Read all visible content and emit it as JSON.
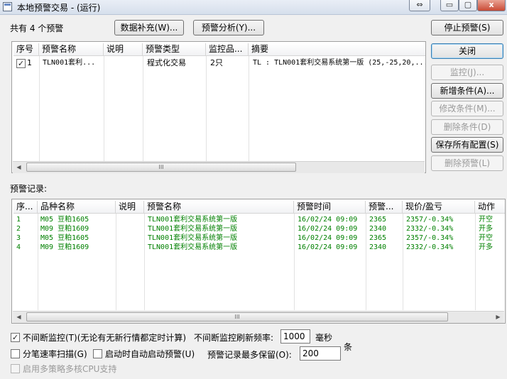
{
  "window": {
    "title": "本地预警交易 - (运行)",
    "icon": "window-app-icon",
    "controls": {
      "restore": "⇔",
      "minimize": "▭",
      "close": "x"
    }
  },
  "top": {
    "count_label": "共有 4 个预警",
    "supplement_button": "数据补充(W)...",
    "analysis_button": "预警分析(Y)..."
  },
  "alerts_table": {
    "columns": [
      "序号",
      "预警名称",
      "说明",
      "预警类型",
      "监控品...",
      "摘要"
    ],
    "rows": [
      {
        "checked": true,
        "index": "1",
        "name": "TLN001套利...",
        "desc": "",
        "type": "程式化交易",
        "monitor": "2只",
        "summary": "TL : TLN001套利交易系统第一版 (25,-25,20,..."
      }
    ],
    "scroll_thumb": "III"
  },
  "side_buttons": {
    "stop": "停止预警(S)",
    "close": "关闭",
    "monitor": "监控(J)...",
    "add": "新增条件(A)...",
    "modify": "修改条件(M)...",
    "delete_cond": "删除条件(D)",
    "save_all": "保存所有配置(S)",
    "delete_alert": "删除预警(L)"
  },
  "records": {
    "label": "预警记录:",
    "columns": [
      "序...",
      "品种名称",
      "说明",
      "预警名称",
      "预警时间",
      "预警...",
      "现价/盈亏",
      "动作"
    ],
    "rows": [
      {
        "index": "1",
        "product": "M05 豆粕1605",
        "desc": "",
        "alert": "TLN001套利交易系统第一版",
        "time": "16/02/24 09:09",
        "price": "2365",
        "current": "2357/-0.34%",
        "action": "开空"
      },
      {
        "index": "2",
        "product": "M09 豆粕1609",
        "desc": "",
        "alert": "TLN001套利交易系统第一版",
        "time": "16/02/24 09:09",
        "price": "2340",
        "current": "2332/-0.34%",
        "action": "开多"
      },
      {
        "index": "3",
        "product": "M05 豆粕1605",
        "desc": "",
        "alert": "TLN001套利交易系统第一版",
        "time": "16/02/24 09:09",
        "price": "2365",
        "current": "2357/-0.34%",
        "action": "开空"
      },
      {
        "index": "4",
        "product": "M09 豆粕1609",
        "desc": "",
        "alert": "TLN001套利交易系统第一版",
        "time": "16/02/24 09:09",
        "price": "2340",
        "current": "2332/-0.34%",
        "action": "开多"
      }
    ],
    "text_color": "#008000",
    "scroll_thumb": "III"
  },
  "options": {
    "continuous_monitor": {
      "checked": true,
      "label": "不间断监控(T)(无论有无新行情都定时计算)"
    },
    "refresh_label": "不间断监控刷新频率:",
    "refresh_value": "1000",
    "refresh_unit": "毫秒",
    "tick_scan": {
      "checked": false,
      "label": "分笔速率扫描(G)"
    },
    "auto_start": {
      "checked": false,
      "label": "启动时自动启动预警(U)"
    },
    "max_records_label": "预警记录最多保留(O):",
    "max_records_value": "200",
    "max_records_unit": "条",
    "multi_cpu": {
      "checked": false,
      "label": "启用多策略多核CPU支持"
    }
  }
}
